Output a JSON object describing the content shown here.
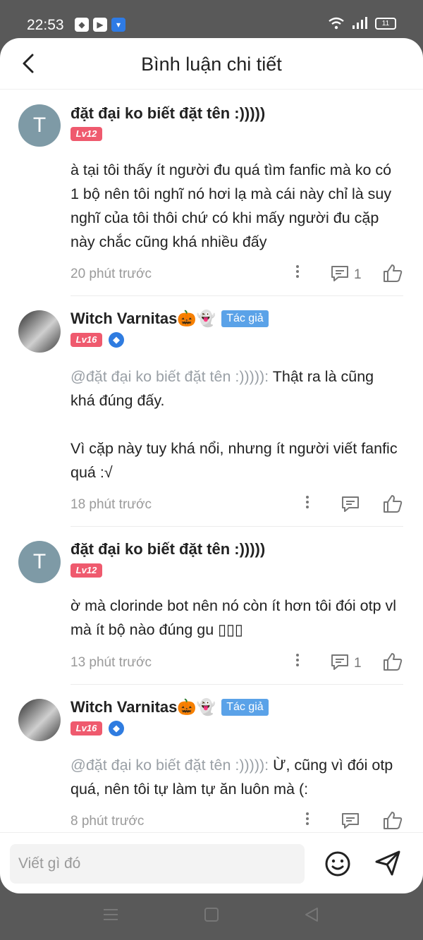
{
  "status": {
    "time": "22:53",
    "battery": "11"
  },
  "header": {
    "title": "Bình luận chi tiết"
  },
  "comments": [
    {
      "avatar_letter": "T",
      "name": "đặt đại ko biết đặt tên :)))))",
      "level": "Lv12",
      "text": "à tại tôi thấy ít người đu quá tìm fanfic mà ko có 1 bộ nên tôi nghĩ nó hơi lạ mà cái này chỉ là suy nghĩ của tôi thôi chứ có khi mấy người đu cặp này chắc cũng khá nhiều đấy",
      "time": "20 phút trước",
      "reply_count": "1"
    },
    {
      "name": "Witch Varnitas🎃👻",
      "author_badge": "Tác giả",
      "level": "Lv16",
      "mention": "@đặt đại ko biết đặt tên :))))):",
      "text": " Thật ra là cũng khá đúng đấy.",
      "text2": "Vì cặp này tuy khá nổi, nhưng ít người viết fanfic quá :√",
      "time": "18 phút trước"
    },
    {
      "avatar_letter": "T",
      "name": "đặt đại ko biết đặt tên :)))))",
      "level": "Lv12",
      "text": "ờ mà clorinde bot nên nó còn ít hơn tôi đói otp vl mà ít bộ nào đúng gu ▯▯▯",
      "time": "13 phút trước",
      "reply_count": "1"
    },
    {
      "name": "Witch Varnitas🎃👻",
      "author_badge": "Tác giả",
      "level": "Lv16",
      "mention": "@đặt đại ko biết đặt tên :))))):",
      "text": " Ừ, cũng vì đói otp quá, nên tôi tự làm tự ăn luôn mà (:",
      "time": "8 phút trước"
    }
  ],
  "composer": {
    "placeholder": "Viết gì đó"
  },
  "icons": {
    "back": "chevron-left-icon",
    "more": "more-vertical-icon",
    "reply": "comment-icon",
    "like": "thumbs-up-icon",
    "emoji": "smile-icon",
    "send": "send-icon"
  }
}
